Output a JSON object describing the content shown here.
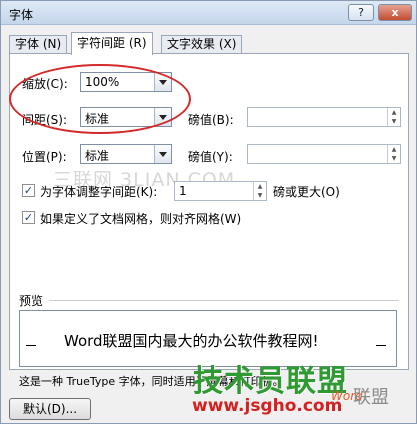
{
  "window": {
    "title": "字体",
    "help_label": "?",
    "close_label": "x"
  },
  "tabs": [
    {
      "label": "字体 (N)"
    },
    {
      "label": "字符间距 (R)"
    },
    {
      "label": "文字效果 (X)"
    }
  ],
  "spacing": {
    "scale_label": "缩放(C):",
    "scale_value": "100%",
    "spacing_label": "间距(S):",
    "spacing_value": "标准",
    "spacing_by_label": "磅值(B):",
    "spacing_by_value": "",
    "position_label": "位置(P):",
    "position_value": "标准",
    "position_by_label": "磅值(Y):",
    "position_by_value": ""
  },
  "kerning": {
    "label": "为字体调整字间距(K):",
    "value": "1",
    "suffix": "磅或更大(O)",
    "checked": true
  },
  "grid": {
    "label": "如果定义了文档网格，则对齐网格(W)",
    "checked": true
  },
  "preview": {
    "title": "预览",
    "text": "Word联盟国内最大的办公软件教程网!",
    "description": "这是一种 TrueType 字体，同时适用于屏幕和打印机。"
  },
  "buttons": {
    "default_label": "默认(D)..."
  },
  "watermarks": {
    "mid": "三联网 3LIAN.COM",
    "brand": "技术员联盟",
    "url": "www.jsgho.com",
    "word": "Word",
    "lianmeng": "联盟"
  },
  "colors": {
    "highlight_ellipse": "#d42a2a",
    "brand_green": "#2f9a31",
    "url_red": "#d42121"
  }
}
